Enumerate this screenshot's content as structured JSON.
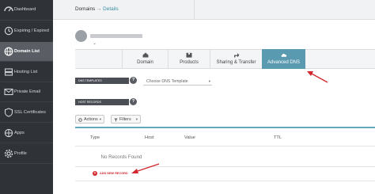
{
  "sidebar": {
    "items": [
      {
        "label": "Dashboard",
        "icon": "dashboard-icon"
      },
      {
        "label": "Expiring / Expired",
        "icon": "clock-icon"
      },
      {
        "label": "Domain List",
        "icon": "globe-icon",
        "active": true
      },
      {
        "label": "Hosting List",
        "icon": "server-icon"
      },
      {
        "label": "Private Email",
        "icon": "email-icon"
      },
      {
        "label": "SSL Certificates",
        "icon": "shield-icon"
      },
      {
        "label": "Apps",
        "icon": "apps-icon"
      },
      {
        "label": "Profile",
        "icon": "gear-icon"
      }
    ]
  },
  "header": {
    "breadcrumb_root": "Domains",
    "breadcrumb_sep": "→",
    "breadcrumb_current": "Details"
  },
  "tabs": [
    {
      "label": "Domain",
      "icon": "home-icon"
    },
    {
      "label": "Products",
      "icon": "box-icon"
    },
    {
      "label": "Sharing & Transfer",
      "icon": "share-icon"
    },
    {
      "label": "Advanced DNS",
      "icon": "dns-icon",
      "active": true
    }
  ],
  "dns_templates": {
    "label": "DNS TEMPLATES",
    "help": "?",
    "select_value": "Choose DNS Template",
    "chevron": "▾"
  },
  "host_records": {
    "label": "HOST RECORDS",
    "help": "?",
    "actions_label": "Actions",
    "filters_label": "Filters",
    "chevron": "▾",
    "columns": [
      "Type",
      "Host",
      "Value",
      "TTL"
    ],
    "empty_text": "No Records Found",
    "add_label": "ADD NEW RECORD",
    "add_icon_glyph": "+"
  },
  "colors": {
    "sidebar_bg": "#2f3237",
    "accent": "#5a9ab0",
    "annotation_red": "#d0282e"
  }
}
